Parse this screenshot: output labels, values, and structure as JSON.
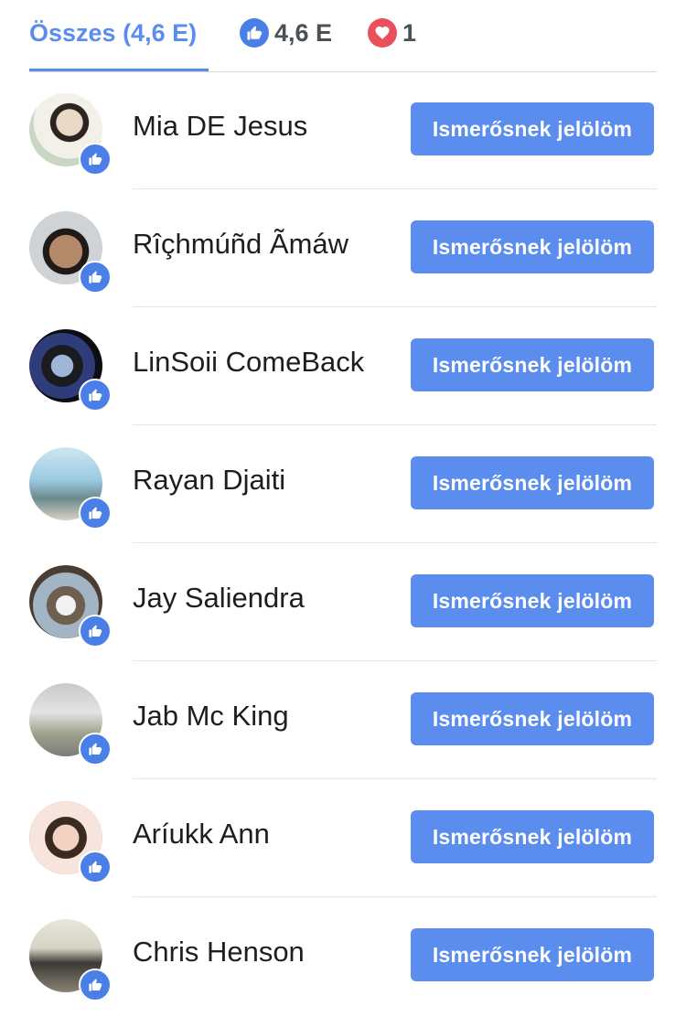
{
  "tabs": {
    "all_label": "Összes (4,6 E)",
    "like_count": "4,6 E",
    "love_count": "1",
    "like_icon": "thumbs-up-icon",
    "love_icon": "heart-icon"
  },
  "colors": {
    "accent": "#5b8def",
    "like": "#4a7fe8",
    "love": "#e8505b"
  },
  "people": [
    {
      "name": "Mia DE Jesus",
      "button": "Ismerősnek jelölöm",
      "reaction": "like"
    },
    {
      "name": "Rîçhmúñd Ãmáw",
      "button": "Ismerősnek jelölöm",
      "reaction": "like"
    },
    {
      "name": "LinSoii ComeBack",
      "button": "Ismerősnek jelölöm",
      "reaction": "like"
    },
    {
      "name": "Rayan Djaiti",
      "button": "Ismerősnek jelölöm",
      "reaction": "like"
    },
    {
      "name": "Jay Saliendra",
      "button": "Ismerősnek jelölöm",
      "reaction": "like"
    },
    {
      "name": "Jab Mc King",
      "button": "Ismerősnek jelölöm",
      "reaction": "like"
    },
    {
      "name": "Aríukk Ann",
      "button": "Ismerősnek jelölöm",
      "reaction": "like"
    },
    {
      "name": "Chris Henson",
      "button": "Ismerősnek jelölöm",
      "reaction": "like"
    }
  ]
}
